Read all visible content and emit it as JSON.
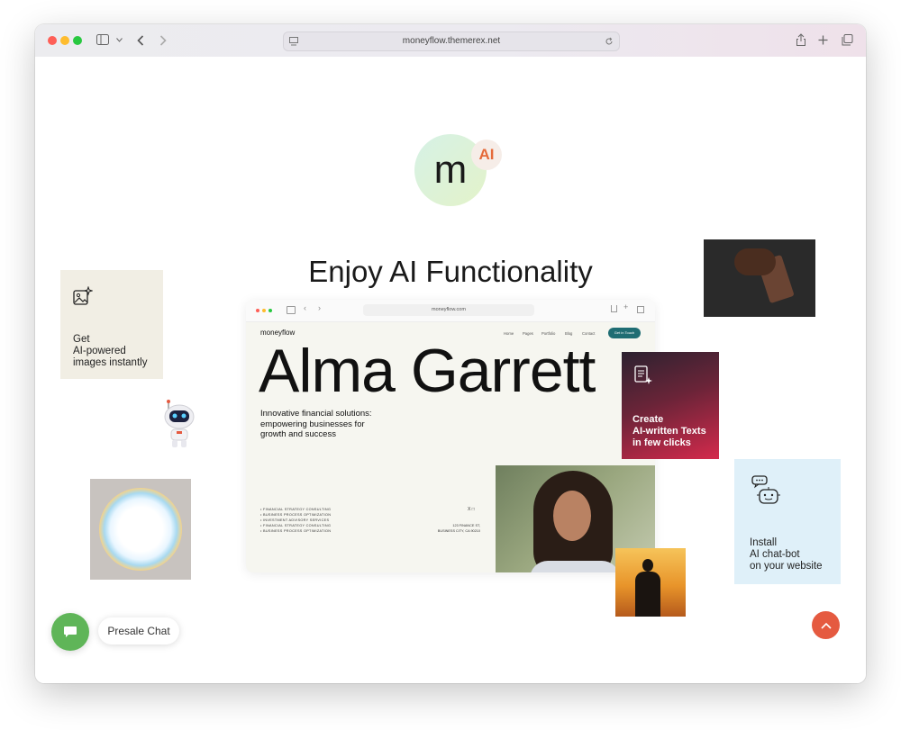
{
  "browser": {
    "url": "moneyflow.themerex.net",
    "icons": [
      "sidebar-icon",
      "chevron-down-icon",
      "back-icon",
      "forward-icon",
      "reader-icon",
      "reload-icon",
      "share-icon",
      "plus-icon",
      "tabs-icon"
    ]
  },
  "hero": {
    "logo_letter": "m",
    "ai_badge": "AI",
    "headline": "Enjoy AI Functionality"
  },
  "cards": {
    "images": {
      "text": "Get\nAI-powered\nimages instantly",
      "icon": "sparkle-image-icon"
    },
    "texts": {
      "text": "Create\nAI-written Texts\nin few clicks",
      "icon": "document-sparkle-icon"
    },
    "chatbot": {
      "text": "Install\nAI chat-bot\non your website",
      "icon": "chatbot-icon"
    }
  },
  "mock_site": {
    "url": "moneyflow.com",
    "brand": "moneyflow",
    "nav": [
      "Home",
      "Pages",
      "Portfolio",
      "Blog",
      "Contact"
    ],
    "cta": "Get in Touch",
    "name": "Alma Garrett",
    "subtitle": "Innovative financial solutions:\nempowering businesses for\ngrowth and success",
    "services": [
      "FINANCIAL STRATEGY CONSULTING",
      "BUSINESS PROCESS OPTIMIZATION",
      "INVESTMENT ADVISORY SERVICES",
      "FINANCIAL STRATEGY CONSULTING",
      "BUSINESS PROCESS OPTIMIZATION"
    ],
    "address": "123 FINANCE ST,\nBUSINESS CITY, CA 90210",
    "social": "X  □"
  },
  "chat": {
    "label": "Presale Chat",
    "icon": "chat-bubble-icon"
  },
  "scroll_top": {
    "icon": "chevron-up-icon"
  },
  "colors": {
    "accent": "#e55a40",
    "chat_green": "#5fb558",
    "ai_orange": "#e56a3a",
    "mock_cta": "#1f6d73"
  }
}
